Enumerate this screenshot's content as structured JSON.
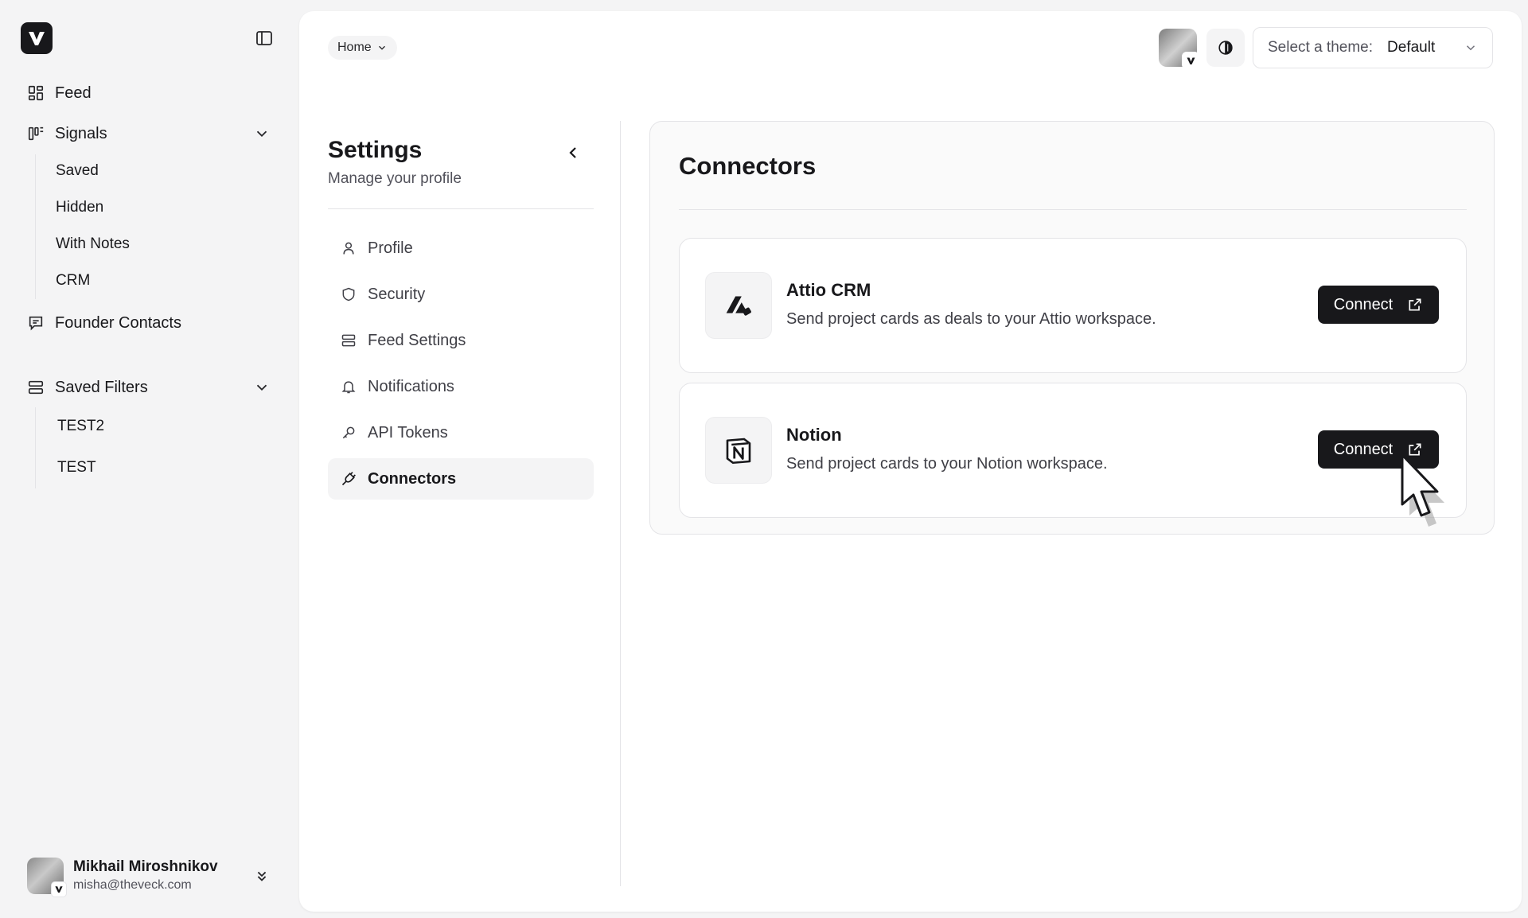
{
  "sidebar": {
    "nav": {
      "feed": "Feed",
      "signals": "Signals",
      "founder_contacts": "Founder Contacts",
      "saved_filters": "Saved Filters"
    },
    "signals_children": [
      "Saved",
      "Hidden",
      "With Notes",
      "CRM"
    ],
    "saved_filters_children": [
      "TEST2",
      "TEST"
    ],
    "user": {
      "name": "Mikhail Miroshnikov",
      "email": "misha@theveck.com"
    }
  },
  "header": {
    "breadcrumb": "Home",
    "theme_label": "Select a theme:",
    "theme_value": "Default"
  },
  "settings": {
    "title": "Settings",
    "subtitle": "Manage your profile",
    "nav": [
      "Profile",
      "Security",
      "Feed Settings",
      "Notifications",
      "API Tokens",
      "Connectors"
    ],
    "active": "Connectors"
  },
  "connectors": {
    "title": "Connectors",
    "items": [
      {
        "name": "Attio CRM",
        "description": "Send project cards as deals to your Attio workspace.",
        "button": "Connect",
        "icon": "attio-logo-icon"
      },
      {
        "name": "Notion",
        "description": "Send project cards to your Notion workspace.",
        "button": "Connect",
        "icon": "notion-logo-icon"
      }
    ]
  },
  "colors": {
    "accent": "#18181b",
    "background": "#f4f4f5",
    "panel": "#ffffff"
  }
}
